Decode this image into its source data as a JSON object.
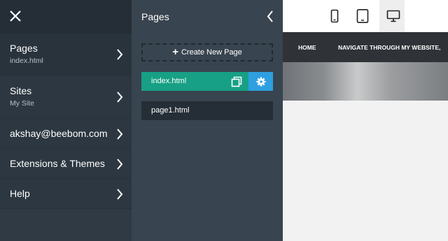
{
  "sidebar": {
    "items": [
      {
        "title": "Pages",
        "subtitle": "index.html"
      },
      {
        "title": "Sites",
        "subtitle": "My Site"
      },
      {
        "title": "akshay@beebom.com"
      },
      {
        "title": "Extensions & Themes"
      },
      {
        "title": "Help"
      }
    ]
  },
  "pages_panel": {
    "title": "Pages",
    "create_label": "Create New Page",
    "pages": [
      "index.html",
      "page1.html"
    ]
  },
  "preview": {
    "nav": [
      "HOME",
      "NAVIGATE THROUGH MY WEBSITE,"
    ]
  },
  "colors": {
    "accent": "#17a085",
    "gear": "#2e9fe0"
  }
}
